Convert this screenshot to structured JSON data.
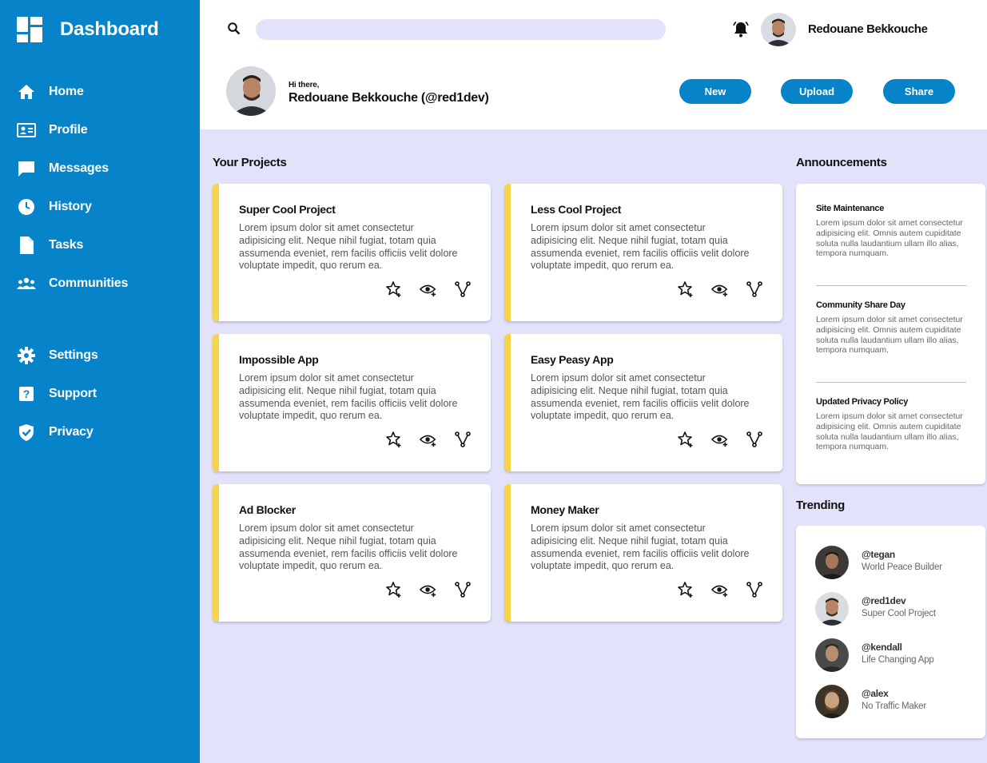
{
  "sidebar": {
    "title": "Dashboard",
    "nav_main": [
      {
        "label": "Home",
        "icon": "home-icon"
      },
      {
        "label": "Profile",
        "icon": "profile-card-icon"
      },
      {
        "label": "Messages",
        "icon": "message-icon"
      },
      {
        "label": "History",
        "icon": "clock-icon"
      },
      {
        "label": "Tasks",
        "icon": "document-icon"
      },
      {
        "label": "Communities",
        "icon": "people-icon"
      }
    ],
    "nav_secondary": [
      {
        "label": "Settings",
        "icon": "gear-icon"
      },
      {
        "label": "Support",
        "icon": "help-icon"
      },
      {
        "label": "Privacy",
        "icon": "shield-check-icon"
      }
    ]
  },
  "header": {
    "search_placeholder": "",
    "user_name": "Redouane Bekkouche",
    "greeting": "Hi there,",
    "handle": "Redouane Bekkouche (@red1dev)",
    "buttons": {
      "new": "New",
      "upload": "Upload",
      "share": "Share"
    }
  },
  "projects": {
    "title": "Your Projects",
    "items": [
      {
        "title": "Super Cool Project",
        "desc": "Lorem ipsum dolor sit amet consectetur adipisicing elit. Neque nihil fugiat, totam quia assumenda eveniet, rem facilis officiis velit dolore voluptate impedit, quo rerum ea."
      },
      {
        "title": "Less Cool Project",
        "desc": "Lorem ipsum dolor sit amet consectetur adipisicing elit. Neque nihil fugiat, totam quia assumenda eveniet, rem facilis officiis velit dolore voluptate impedit, quo rerum ea."
      },
      {
        "title": "Impossible App",
        "desc": "Lorem ipsum dolor sit amet consectetur adipisicing elit. Neque nihil fugiat, totam quia assumenda eveniet, rem facilis officiis velit dolore voluptate impedit, quo rerum ea."
      },
      {
        "title": "Easy Peasy App",
        "desc": "Lorem ipsum dolor sit amet consectetur adipisicing elit. Neque nihil fugiat, totam quia assumenda eveniet, rem facilis officiis velit dolore voluptate impedit, quo rerum ea."
      },
      {
        "title": "Ad Blocker",
        "desc": "Lorem ipsum dolor sit amet consectetur adipisicing elit. Neque nihil fugiat, totam quia assumenda eveniet, rem facilis officiis velit dolore voluptate impedit, quo rerum ea."
      },
      {
        "title": "Money Maker",
        "desc": "Lorem ipsum dolor sit amet consectetur adipisicing elit. Neque nihil fugiat, totam quia assumenda eveniet, rem facilis officiis velit dolore voluptate impedit, quo rerum ea."
      }
    ]
  },
  "announcements": {
    "title": "Announcements",
    "items": [
      {
        "title": "Site Maintenance",
        "text": "Lorem ipsum dolor sit amet consectetur adipisicing elit. Omnis autem cupiditate soluta nulla laudantium ullam illo alias, tempora numquam."
      },
      {
        "title": "Community Share Day",
        "text": "Lorem ipsum dolor sit amet consectetur adipisicing elit. Omnis autem cupiditate soluta nulla laudantium ullam illo alias, tempora numquam."
      },
      {
        "title": "Updated Privacy Policy",
        "text": "Lorem ipsum dolor sit amet consectetur adipisicing elit. Omnis autem cupiditate soluta nulla laudantium ullam illo alias, tempora numquam."
      }
    ]
  },
  "trending": {
    "title": "Trending",
    "items": [
      {
        "handle": "@tegan",
        "project": "World Peace Builder"
      },
      {
        "handle": "@red1dev",
        "project": "Super Cool Project"
      },
      {
        "handle": "@kendall",
        "project": "Life Changing App"
      },
      {
        "handle": "@alex",
        "project": "No Traffic Maker"
      }
    ]
  },
  "colors": {
    "brand": "#0784c9",
    "background": "#e2e3fa",
    "card_accent": "#f7d44a"
  }
}
